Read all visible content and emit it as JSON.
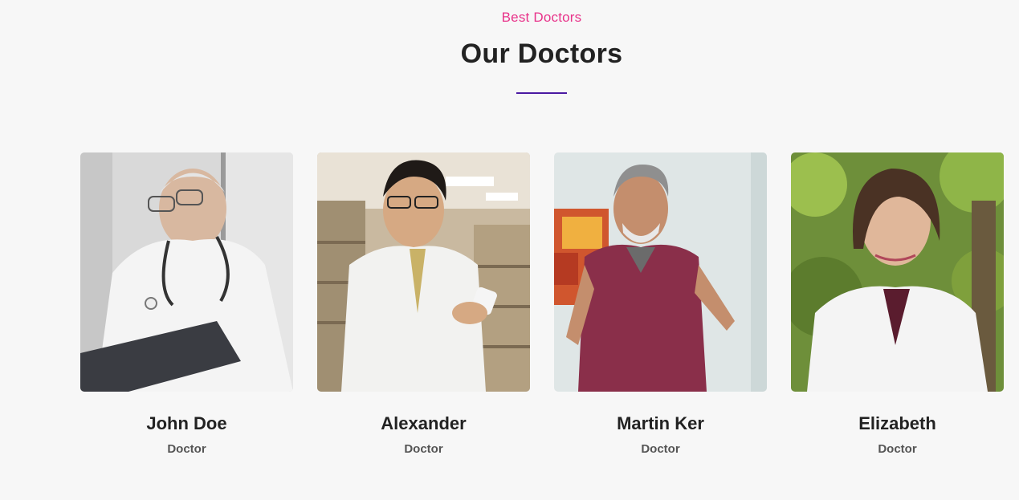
{
  "section": {
    "eyebrow": "Best Doctors",
    "title": "Our Doctors",
    "accent_color": "#e8338a",
    "divider_color": "#4b1aa2"
  },
  "doctors": [
    {
      "name": "John Doe",
      "role": "Doctor"
    },
    {
      "name": "Alexander",
      "role": "Doctor"
    },
    {
      "name": "Martin Ker",
      "role": "Doctor"
    },
    {
      "name": "Elizabeth",
      "role": "Doctor"
    }
  ]
}
